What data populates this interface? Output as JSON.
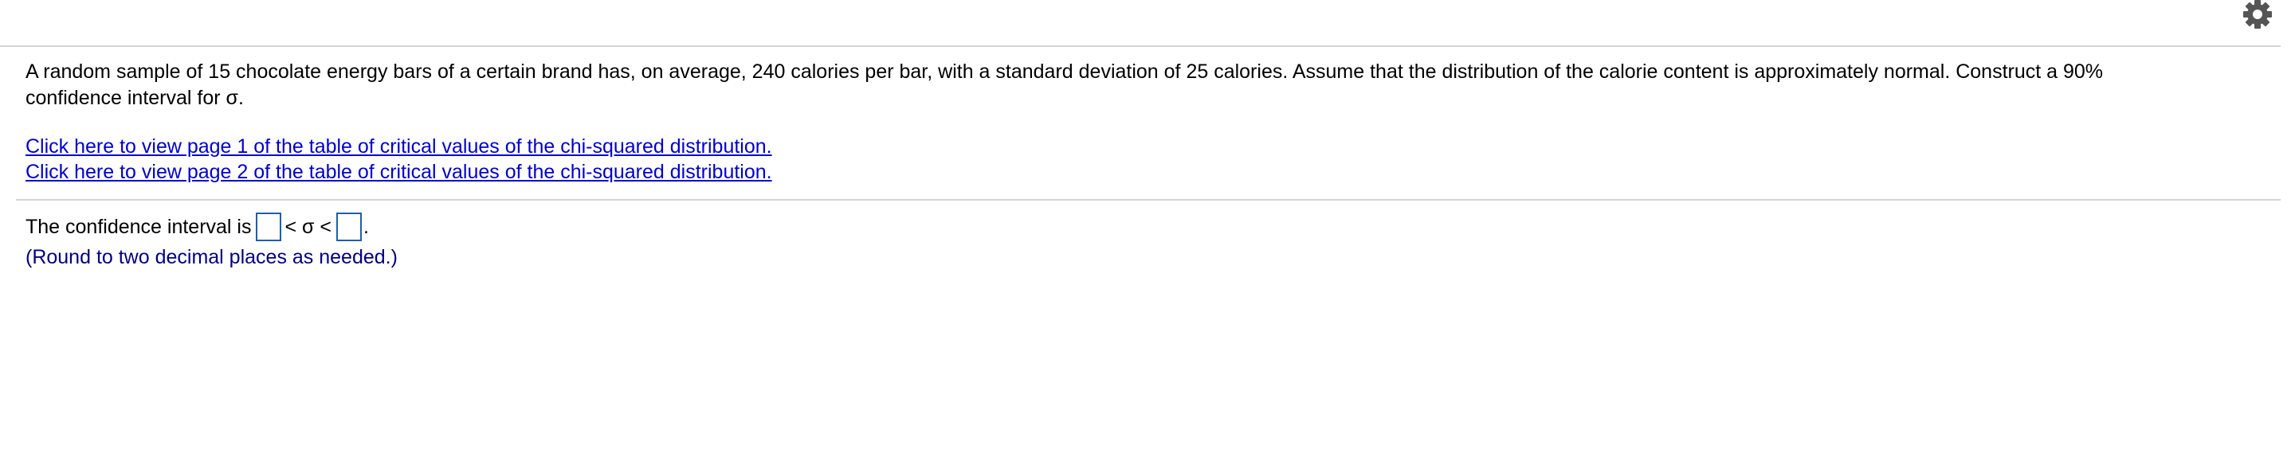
{
  "toolbar": {
    "settings_icon": "gear-icon"
  },
  "question": {
    "text_line1": "A random sample of 15 chocolate energy bars of a certain brand has, on average, 240 calories per bar, with a standard deviation of 25 calories. Assume that the distribution of the calorie content is approximately normal. Construct a 90%",
    "text_line2": "confidence interval for σ."
  },
  "links": {
    "page1": "Click here to view page 1 of the table of critical values of the chi-squared distribution.",
    "page2": "Click here to view page 2 of the table of critical values of the chi-squared distribution."
  },
  "answer": {
    "prefix": "The confidence interval is",
    "middle": "< σ <",
    "suffix": ".",
    "lower_value": "",
    "upper_value": "",
    "hint": "(Round to two decimal places as needed.)"
  },
  "colors": {
    "link": "#0000cc",
    "hint": "#000080",
    "input_border": "#1f5fa8",
    "rule": "#d4d4d4"
  }
}
